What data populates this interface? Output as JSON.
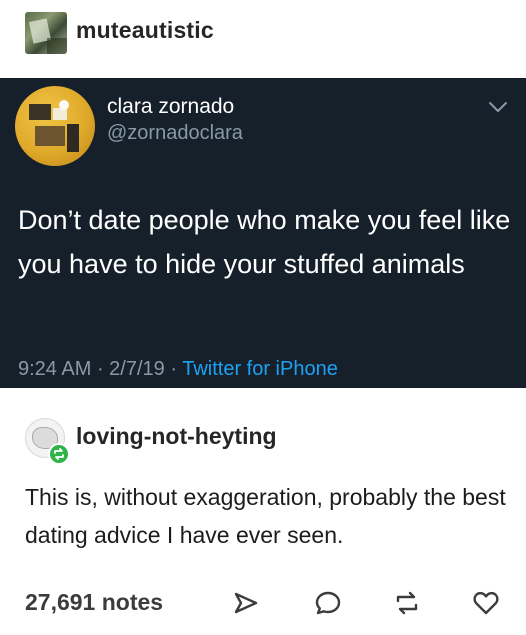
{
  "post": {
    "op_username": "muteautistic",
    "tweet": {
      "display_name": "clara zornado",
      "handle": "@zornadoclara",
      "text": "Don’t date people who make you feel like you have to hide your stuffed animals",
      "time": "9:24 AM",
      "date": "2/7/19",
      "source": "Twitter for iPhone",
      "separator": " · "
    },
    "reblog": {
      "username": "loving-not-heyting",
      "text": "This is, without exaggeration, probably the best dating advice I have ever seen."
    },
    "footer": {
      "notes": "27,691 notes",
      "icons": [
        "share-icon",
        "reply-icon",
        "reblog-icon",
        "like-icon"
      ]
    }
  },
  "colors": {
    "tweet_background": "#15202b",
    "tweet_text": "#ffffff",
    "tweet_secondary": "#8899a6",
    "twitter_blue": "#1da1f2",
    "reblog_badge": "#2fb34a",
    "page_background": "#ffffff"
  }
}
